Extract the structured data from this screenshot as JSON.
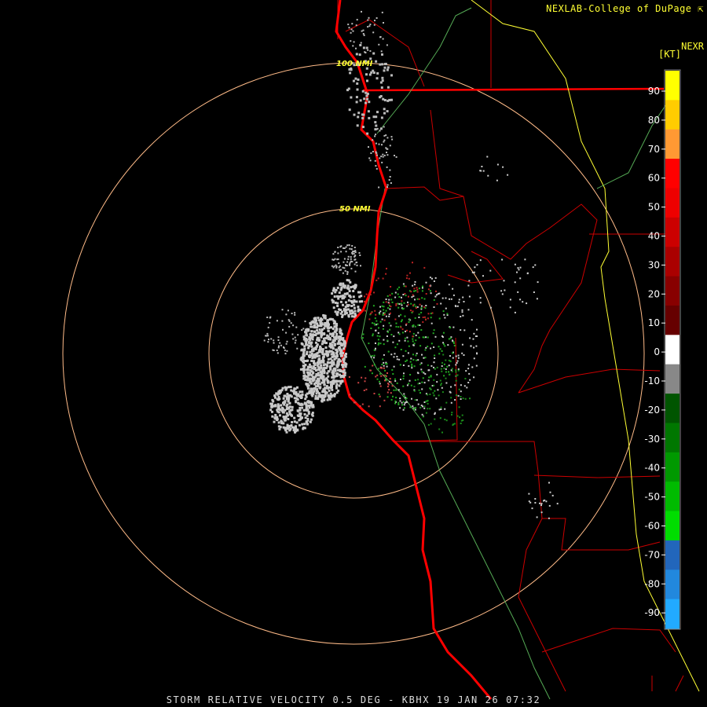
{
  "header": {
    "credit": "NEXLAB-College of DuPage",
    "credit_icon": "link-arrow-icon",
    "product": "NEXR",
    "unit": "[KT]"
  },
  "range_rings": {
    "inner_label": "50 NMI",
    "outer_label": "100 NMI"
  },
  "color_scale": {
    "ticks": [
      "90",
      "80",
      "70",
      "60",
      "50",
      "40",
      "30",
      "20",
      "10",
      "0",
      "-10",
      "-20",
      "-30",
      "-40",
      "-50",
      "-60",
      "-70",
      "-80",
      "-90"
    ],
    "colors": [
      "#ffff00",
      "#ffcc00",
      "#ff9933",
      "#ff0000",
      "#ee0000",
      "#cc0000",
      "#aa0000",
      "#880000",
      "#660000",
      "#ffffff",
      "#888888",
      "#005500",
      "#007700",
      "#009900",
      "#00bb00",
      "#00dd00",
      "#2266bb",
      "#2288dd",
      "#22aaff"
    ]
  },
  "footer": {
    "caption": "STORM RELATIVE VELOCITY 0.5 DEG - KBHX 19 JAN 26 07:32"
  },
  "colors": {
    "background": "#000000",
    "coastline": "#ff0000",
    "county_lines": "#cc0000",
    "state_line": "#ffff00",
    "river_lines": "#55aa55",
    "range_ring": "#ffbb88",
    "inbound": "#22aa22",
    "outbound": "#bb2222",
    "clutter": "#cccccc"
  }
}
